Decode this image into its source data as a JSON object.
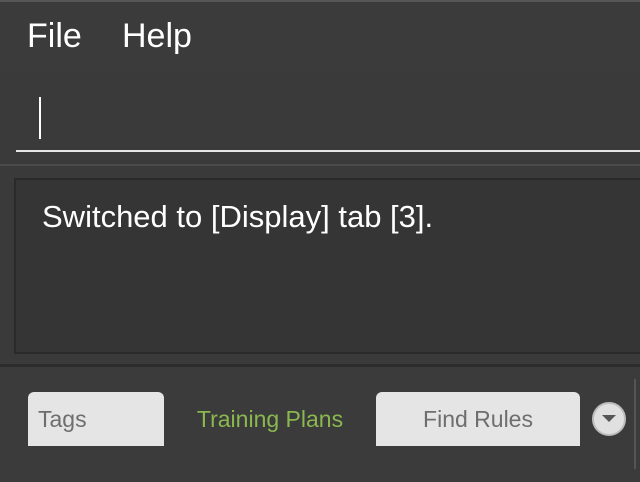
{
  "menu": {
    "file_label": "File",
    "help_label": "Help"
  },
  "command_box": {
    "value": "",
    "placeholder": ""
  },
  "result_display": {
    "message": "Switched to [Display] tab [3]."
  },
  "tabs": [
    {
      "label": "Tags",
      "selected": false
    },
    {
      "label": "Training Plans",
      "selected": true
    },
    {
      "label": "Find Rules",
      "selected": false
    }
  ],
  "tab_overflow": {
    "icon": "chevron-down-icon"
  },
  "colors": {
    "background": "#3a3a3a",
    "text": "#ffffff",
    "selected_tab_text": "#8ab84e",
    "unselected_tab_bg": "#e5e5e5",
    "unselected_tab_text": "#6e6e6e"
  }
}
